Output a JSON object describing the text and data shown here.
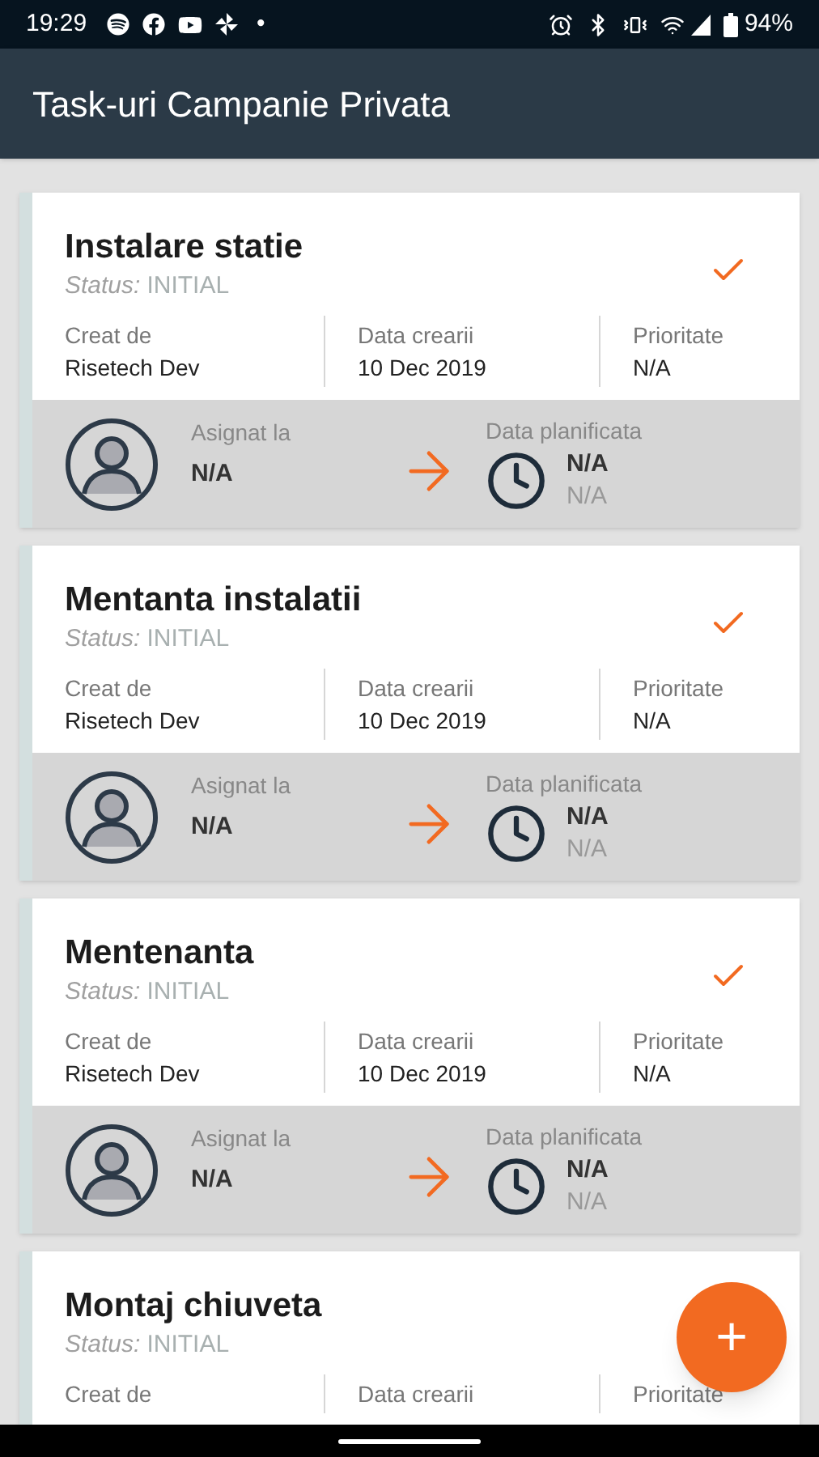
{
  "status_bar": {
    "time": "19:29",
    "dot": "•",
    "battery": "94%"
  },
  "app_bar": {
    "title": "Task-uri Campanie Privata"
  },
  "tasks": [
    {
      "title": "Instalare statie",
      "check_mark": true,
      "status_label": "Status:",
      "status": "INITIAL",
      "fields": [
        {
          "label": "Creat de",
          "value": "Risetech Dev"
        },
        {
          "label": "Data crearii",
          "value": "10 Dec 2019"
        },
        {
          "label": "Prioritate",
          "value": "N/A"
        }
      ],
      "assigned_label": "Asignat la",
      "assigned": "N/A",
      "planned_label": "Data planificata",
      "planned_date": "N/A",
      "planned_time": "N/A"
    },
    {
      "title": "Mentanta instalatii",
      "check_mark": true,
      "status_label": "Status:",
      "status": "INITIAL",
      "fields": [
        {
          "label": "Creat de",
          "value": "Risetech Dev"
        },
        {
          "label": "Data crearii",
          "value": "10 Dec 2019"
        },
        {
          "label": "Prioritate",
          "value": "N/A"
        }
      ],
      "assigned_label": "Asignat la",
      "assigned": "N/A",
      "planned_label": "Data planificata",
      "planned_date": "N/A",
      "planned_time": "N/A"
    },
    {
      "title": "Mentenanta",
      "check_mark": true,
      "status_label": "Status:",
      "status": "INITIAL",
      "fields": [
        {
          "label": "Creat de",
          "value": "Risetech Dev"
        },
        {
          "label": "Data crearii",
          "value": "10 Dec 2019"
        },
        {
          "label": "Prioritate",
          "value": "N/A"
        }
      ],
      "assigned_label": "Asignat la",
      "assigned": "N/A",
      "planned_label": "Data planificata",
      "planned_date": "N/A",
      "planned_time": "N/A"
    },
    {
      "title": "Montaj chiuveta",
      "status_label": "Status:",
      "status": "INITIAL",
      "fields": [
        {
          "label": "Creat de"
        },
        {
          "label": "Data crearii"
        },
        {
          "label": "Prioritate"
        }
      ]
    }
  ],
  "fab": {
    "label": "+"
  }
}
